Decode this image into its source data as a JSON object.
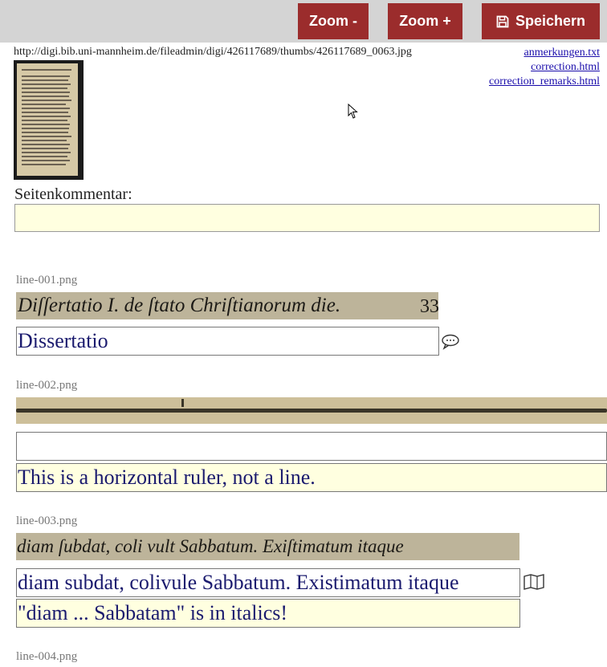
{
  "toolbar": {
    "zoom_out_label": "Zoom -",
    "zoom_in_label": "Zoom +",
    "save_label": "Speichern"
  },
  "page": {
    "image_url": "http://digi.bib.uni-mannheim.de/fileadmin/digi/426117689/thumbs/426117689_0063.jpg",
    "links": [
      "anmerkungen.txt",
      "correction.html",
      "correction_remarks.html"
    ],
    "page_comment_label": "Seitenkommentar:",
    "page_comment_value": ""
  },
  "lines": [
    {
      "filename": "line-001.png",
      "image_text": "Diſſertatio I. de ſtato Chriſtianorum die.",
      "image_page_number": "33",
      "transcription": "Dissertatio",
      "comment": null,
      "icon": "comment-icon"
    },
    {
      "filename": "line-002.png",
      "image_text": "",
      "transcription": "",
      "comment": "This is a horizontal ruler, not a line.",
      "icon": null
    },
    {
      "filename": "line-003.png",
      "image_text": "diam ſubdat, coli vult Sabbatum. Exiſtimatum itaque",
      "transcription": "diam subdat, colivule Sabbatum. Existimatum itaque",
      "comment": "\"diam ... Sabbatam\" is in italics!",
      "icon": "book-icon"
    },
    {
      "filename": "line-004.png"
    }
  ],
  "colors": {
    "button_bg": "#9b2c2c",
    "topbar_bg": "#d4d4d4",
    "comment_bg": "#ffffe0",
    "link": "#1a0dab"
  }
}
